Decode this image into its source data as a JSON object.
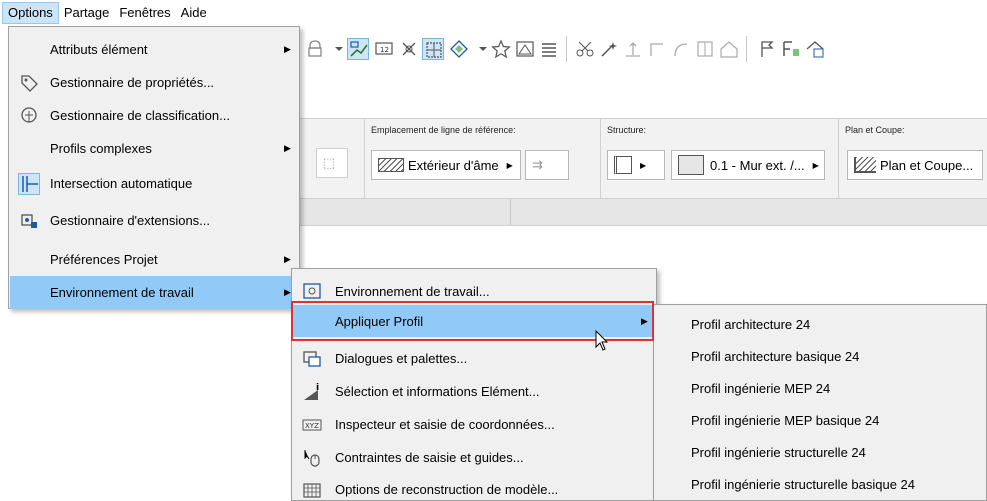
{
  "menubar": {
    "items": [
      "Options",
      "Partage",
      "Fenêtres",
      "Aide"
    ]
  },
  "options_menu": {
    "items": [
      {
        "label": "Attributs élément",
        "access": "A",
        "rest": "ttributs élément",
        "submenu": true,
        "icon": ""
      },
      {
        "label": "Gestionnaire de propriétés...",
        "access": "",
        "rest": "",
        "submenu": false,
        "icon": "tag-icon"
      },
      {
        "label": "Gestionnaire de classification...",
        "access": "",
        "rest": "",
        "submenu": false,
        "icon": "classification-icon"
      },
      {
        "label": "Profils complexes",
        "access": "",
        "rest": "",
        "submenu": true,
        "icon": ""
      },
      {
        "label": "Intersection automatique",
        "access": "",
        "rest": "",
        "submenu": false,
        "icon": "intersection-icon"
      },
      {
        "label": "Gestionnaire d'extensions...",
        "access": "",
        "rest": "",
        "submenu": false,
        "icon": "extensions-icon"
      },
      {
        "label": "Préférences Projet",
        "access": "",
        "rest": "",
        "submenu": true,
        "icon": ""
      },
      {
        "label": "Environnement de travail",
        "access": "",
        "rest": "",
        "submenu": true,
        "icon": ""
      }
    ]
  },
  "env_menu": {
    "items": [
      {
        "label": "Environnement de travail...",
        "submenu": false,
        "icon": "work-environment-icon"
      },
      {
        "label": "Appliquer Profil",
        "submenu": true,
        "icon": ""
      },
      {
        "label": "Dialogues et palettes...",
        "submenu": false,
        "icon": "palettes-icon"
      },
      {
        "label": "Sélection et informations Elément...",
        "submenu": false,
        "icon": "selection-info-icon"
      },
      {
        "label": "Inspecteur et saisie de coordonnées...",
        "submenu": false,
        "icon": "xyz-icon"
      },
      {
        "label": "Contraintes de saisie et guides...",
        "submenu": false,
        "icon": "cursor-guide-icon"
      },
      {
        "label": "Options de reconstruction de modèle...",
        "submenu": false,
        "icon": "rebuild-icon"
      }
    ]
  },
  "profile_menu": {
    "items": [
      "Profil architecture 24",
      "Profil architecture basique 24",
      "Profil ingénierie MEP 24",
      "Profil ingénierie MEP basique 24",
      "Profil ingénierie structurelle 24",
      "Profil ingénierie structurelle basique 24"
    ]
  },
  "infobox": {
    "ref_line_label": "Emplacement de ligne de référence:",
    "ref_line_value": "Extérieur d'âme",
    "structure_label": "Structure:",
    "structure_value": "0.1 - Mur ext. /...",
    "plan_label": "Plan et Coupe:",
    "plan_value": "Plan et Coupe..."
  },
  "colors": {
    "highlight": "#91c9f7",
    "menu_bg": "#f0f0f0",
    "callout": "#e0303a"
  }
}
